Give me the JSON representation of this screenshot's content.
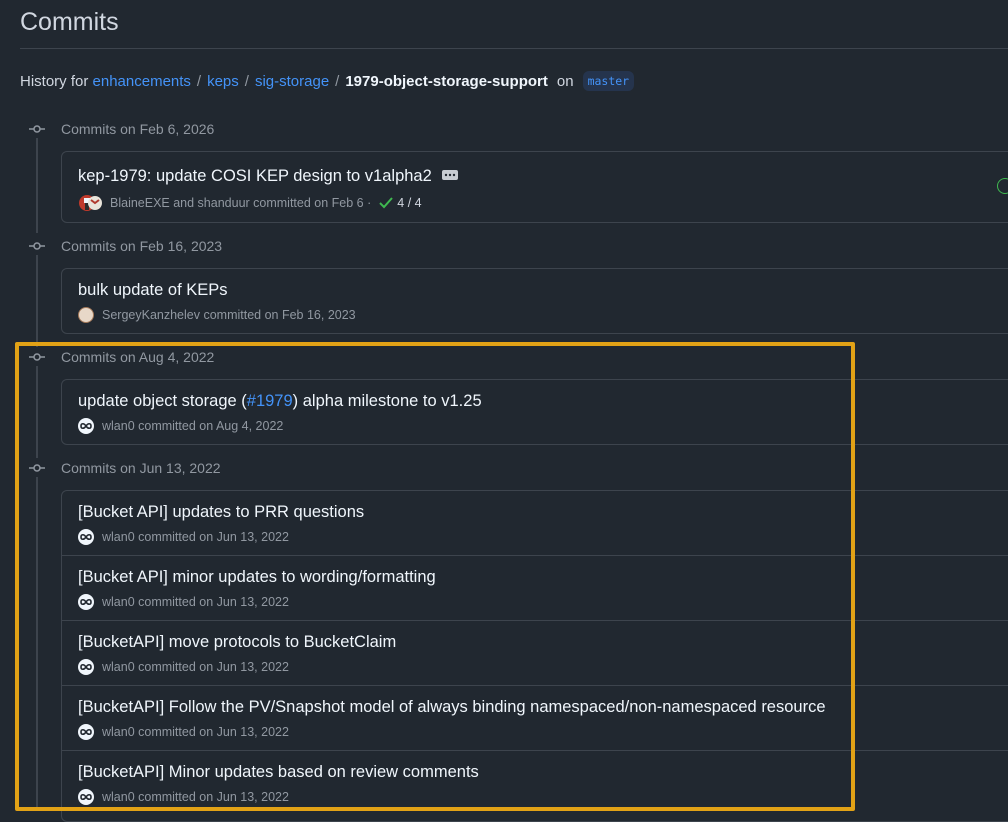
{
  "page_title": "Commits",
  "breadcrumb": {
    "prefix": "History for",
    "items": [
      "enhancements",
      "keps",
      "sig-storage"
    ],
    "current": "1979-object-storage-support",
    "on": "on",
    "branch": "master"
  },
  "groups": [
    {
      "label": "Commits on Feb 6, 2026",
      "commits": [
        {
          "title": "kep-1979: update COSI KEP design to v1alpha2",
          "meta": "BlaineEXE and shanduur committed on Feb 6 ·",
          "checks": "4 / 4"
        }
      ]
    },
    {
      "label": "Commits on Feb 16, 2023",
      "commits": [
        {
          "title": "bulk update of KEPs",
          "meta": "SergeyKanzhelev committed on Feb 16, 2023"
        }
      ]
    },
    {
      "label": "Commits on Aug 4, 2022",
      "commits": [
        {
          "title_before": "update object storage (",
          "title_link": "#1979",
          "title_after": ") alpha milestone to v1.25",
          "meta": "wlan0 committed on Aug 4, 2022"
        }
      ]
    },
    {
      "label": "Commits on Jun 13, 2022",
      "commits": [
        {
          "title": "[Bucket API] updates to PRR questions",
          "meta": "wlan0 committed on Jun 13, 2022"
        },
        {
          "title": "[Bucket API] minor updates to wording/formatting",
          "meta": "wlan0 committed on Jun 13, 2022"
        },
        {
          "title": "[BucketAPI] move protocols to BucketClaim",
          "meta": "wlan0 committed on Jun 13, 2022"
        },
        {
          "title": "[BucketAPI] Follow the PV/Snapshot model of always binding namespaced/non-namespaced resource",
          "meta": "wlan0 committed on Jun 13, 2022"
        },
        {
          "title": "[BucketAPI] Minor updates based on review comments",
          "meta": "wlan0 committed on Jun 13, 2022"
        }
      ]
    }
  ],
  "colors": {
    "highlight": "#e2a216",
    "link": "#4493f8",
    "success": "#3fb950"
  },
  "icons": [
    "git-commit-icon",
    "ellipsis-icon",
    "check-icon",
    "avatar"
  ]
}
